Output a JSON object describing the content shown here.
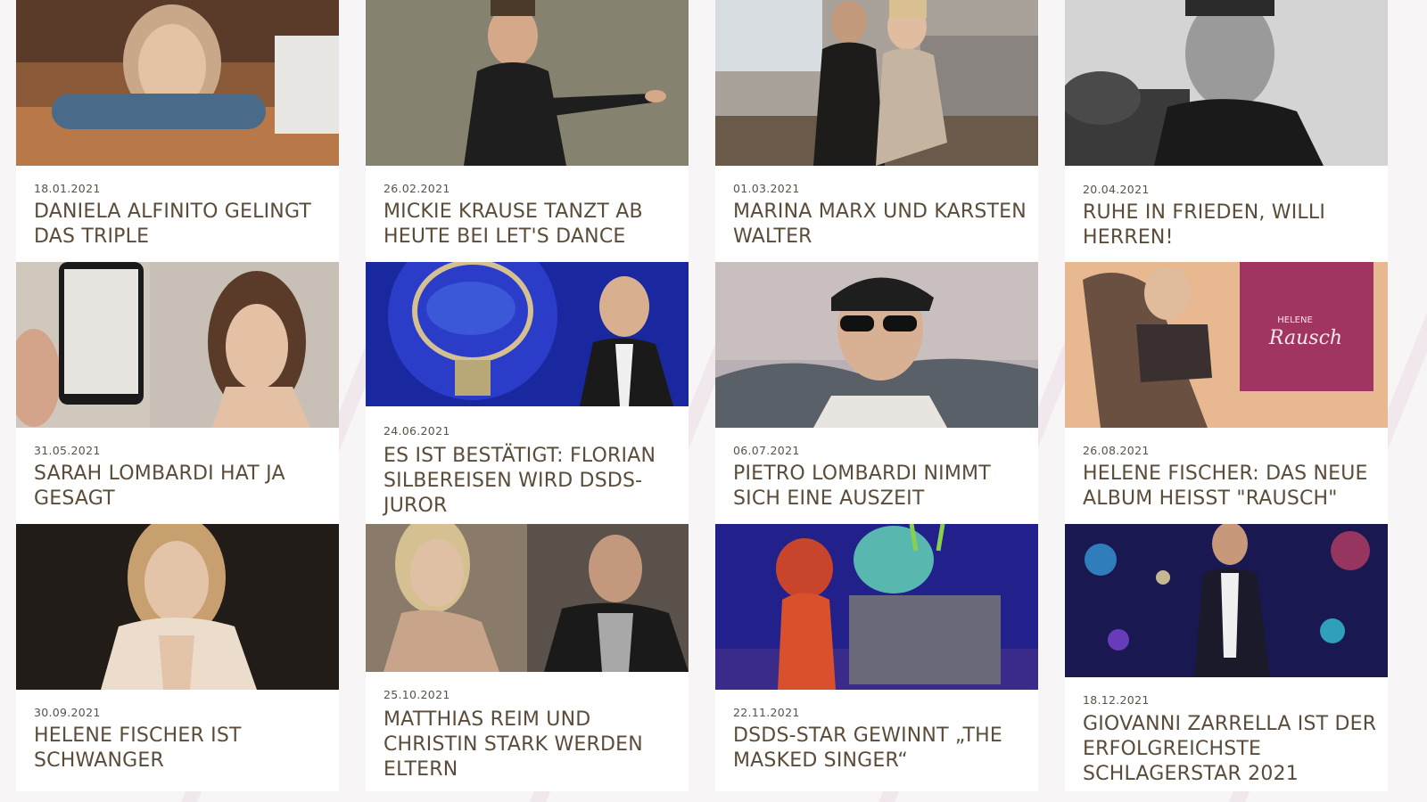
{
  "articles": [
    {
      "date": "18.01.2021",
      "title": "DANIELA ALFINITO GELINGT DAS TRIPLE",
      "image_icon": "woman-on-sofa-photo",
      "colors": [
        "#7a4a2a",
        "#b8b2a8"
      ]
    },
    {
      "date": "26.02.2021",
      "title": "MICKIE KRAUSE TANZT AB HEUTE BEI LET'S DANCE",
      "image_icon": "man-leather-jacket-photo",
      "colors": [
        "#6f6c60",
        "#202020"
      ]
    },
    {
      "date": "01.03.2021",
      "title": "MARINA MARX UND KARSTEN WALTER",
      "image_icon": "couple-on-couch-photo",
      "colors": [
        "#9a9288",
        "#2a2624"
      ]
    },
    {
      "date": "20.04.2021",
      "title": "RUHE IN FRIEDEN, WILLI HERREN!",
      "image_icon": "black-white-portrait-photo",
      "colors": [
        "#d7d7d7",
        "#1c1c1c"
      ]
    },
    {
      "date": "31.05.2021",
      "title": "SARAH LOMBARDI HAT JA GESAGT",
      "image_icon": "woman-with-phone-photo",
      "colors": [
        "#cfc6bd",
        "#4a3528"
      ]
    },
    {
      "date": "24.06.2021",
      "title": "ES IST BESTÄTIGT: FLORIAN SILBEREISEN WIRD DSDS-JUROR",
      "image_icon": "superstar-trophy-photo",
      "colors": [
        "#1c2ea8",
        "#2a2a2a"
      ]
    },
    {
      "date": "06.07.2021",
      "title": "PIETRO LOMBARDI NIMMT SICH EINE AUSZEIT",
      "image_icon": "man-with-cap-photo",
      "colors": [
        "#c9c4c6",
        "#1f1f1f"
      ]
    },
    {
      "date": "26.08.2021",
      "title": "HELENE FISCHER: DAS NEUE ALBUM HEISST \"RAUSCH\"",
      "image_icon": "album-cover-photo",
      "colors": [
        "#e8b48a",
        "#d8342a"
      ],
      "overlay_text": [
        "HELENE",
        "Rausch"
      ]
    },
    {
      "date": "30.09.2021",
      "title": "HELENE FISCHER IST SCHWANGER",
      "image_icon": "woman-portrait-dark-photo",
      "colors": [
        "#1e1a17",
        "#e6d2bf"
      ]
    },
    {
      "date": "25.10.2021",
      "title": "MATTHIAS REIM UND CHRISTIN STARK WERDEN ELTERN",
      "image_icon": "couple-split-photo",
      "colors": [
        "#b0a89c",
        "#2a2826"
      ]
    },
    {
      "date": "22.11.2021",
      "title": "DSDS-STAR GEWINNT „THE MASKED SINGER“",
      "image_icon": "masked-singer-photo",
      "colors": [
        "#2a2a9a",
        "#d83828"
      ]
    },
    {
      "date": "18.12.2021",
      "title": "GIOVANNI ZARRELLA IST DER ERFOLGREICHSTE SCHLAGERSTAR 2021",
      "image_icon": "man-on-stage-photo",
      "colors": [
        "#1a1a5a",
        "#3aa8e8"
      ]
    }
  ]
}
